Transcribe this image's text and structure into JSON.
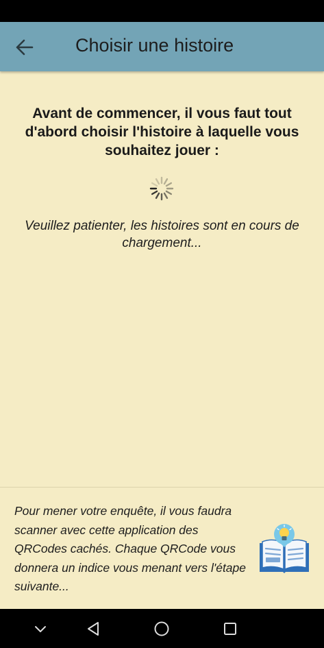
{
  "header": {
    "back_icon": "arrow-left-icon",
    "title": "Choisir une histoire",
    "color": "#73a4b6"
  },
  "main": {
    "heading": "Avant de commencer, il vous faut tout d'abord choisir l'histoire à laquelle vous souhaitez jouer :",
    "spinner_icon": "loading-spinner-icon",
    "loading_text": "Veuillez patienter, les histoires sont en cours de chargement..."
  },
  "footer": {
    "text": "Pour mener votre enquête, il vous faudra scanner avec cette application des QRCodes cachés. Chaque QRCode vous donnera un indice vous menant vers l'étape suivante...",
    "illustration_icon": "book-lightbulb-icon"
  },
  "navigation": {
    "buttons": [
      "chevron-down-icon",
      "back-triangle-icon",
      "home-circle-icon",
      "recents-square-icon"
    ]
  },
  "colors": {
    "background": "#f5ecc5",
    "app_bar": "#73a4b6",
    "system_bars": "#000000"
  }
}
